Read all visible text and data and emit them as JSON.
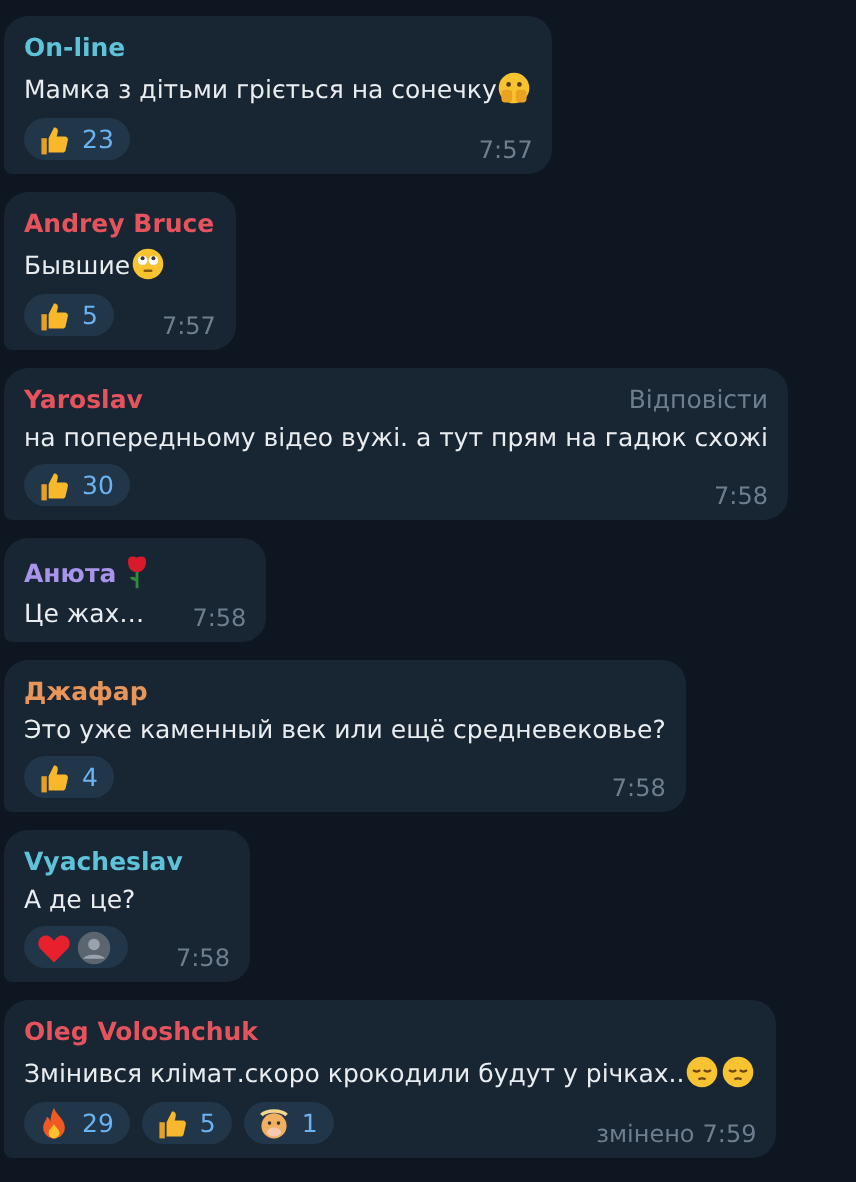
{
  "messages": [
    {
      "author": "On-line",
      "color": "#5ec3d8",
      "text": "Мамка з дітьми гріється на сонечку",
      "text_icons": [
        {
          "kind": "peek"
        }
      ],
      "reactions": [
        {
          "kind": "thumbs",
          "count": "23"
        }
      ],
      "time": "7:57"
    },
    {
      "author": "Andrey Bruce",
      "color": "#e5545c",
      "text": "Бывшие",
      "text_icons": [
        {
          "kind": "rolling"
        }
      ],
      "reactions": [
        {
          "kind": "thumbs",
          "count": "5"
        }
      ],
      "time": "7:57"
    },
    {
      "author": "Yaroslav",
      "color": "#e5545c",
      "action": "Відповісти",
      "text": "на попередньому відео вужі. а тут прям на гадюк схожі",
      "reactions": [
        {
          "kind": "thumbs",
          "count": "30"
        }
      ],
      "time": "7:58"
    },
    {
      "author": "Анюта",
      "color": "#a894ea",
      "author_icon": {
        "kind": "rose"
      },
      "text": "Це жах…",
      "time": "7:58"
    },
    {
      "author": "Джафар",
      "color": "#e8955a",
      "text": "Это уже каменный век или ещё средневековье?",
      "reactions": [
        {
          "kind": "thumbs",
          "count": "4"
        }
      ],
      "time": "7:58"
    },
    {
      "author": "Vyacheslav",
      "color": "#5ec3d8",
      "text": "А де це?",
      "reactions": [
        {
          "kind": "heart",
          "reactor": {
            "kind": "avatar"
          }
        }
      ],
      "time": "7:58"
    },
    {
      "author": "Oleg Voloshchuk",
      "color": "#e5545c",
      "text": "Змінився клімат.скоро крокодили будут у річках..",
      "text_icons": [
        {
          "kind": "pensive"
        },
        {
          "kind": "pensive"
        }
      ],
      "reactions": [
        {
          "kind": "fire",
          "count": "29"
        },
        {
          "kind": "thumbs",
          "count": "5"
        },
        {
          "kind": "cow",
          "count": "1"
        }
      ],
      "edited": "змінено",
      "time": "7:59"
    }
  ]
}
